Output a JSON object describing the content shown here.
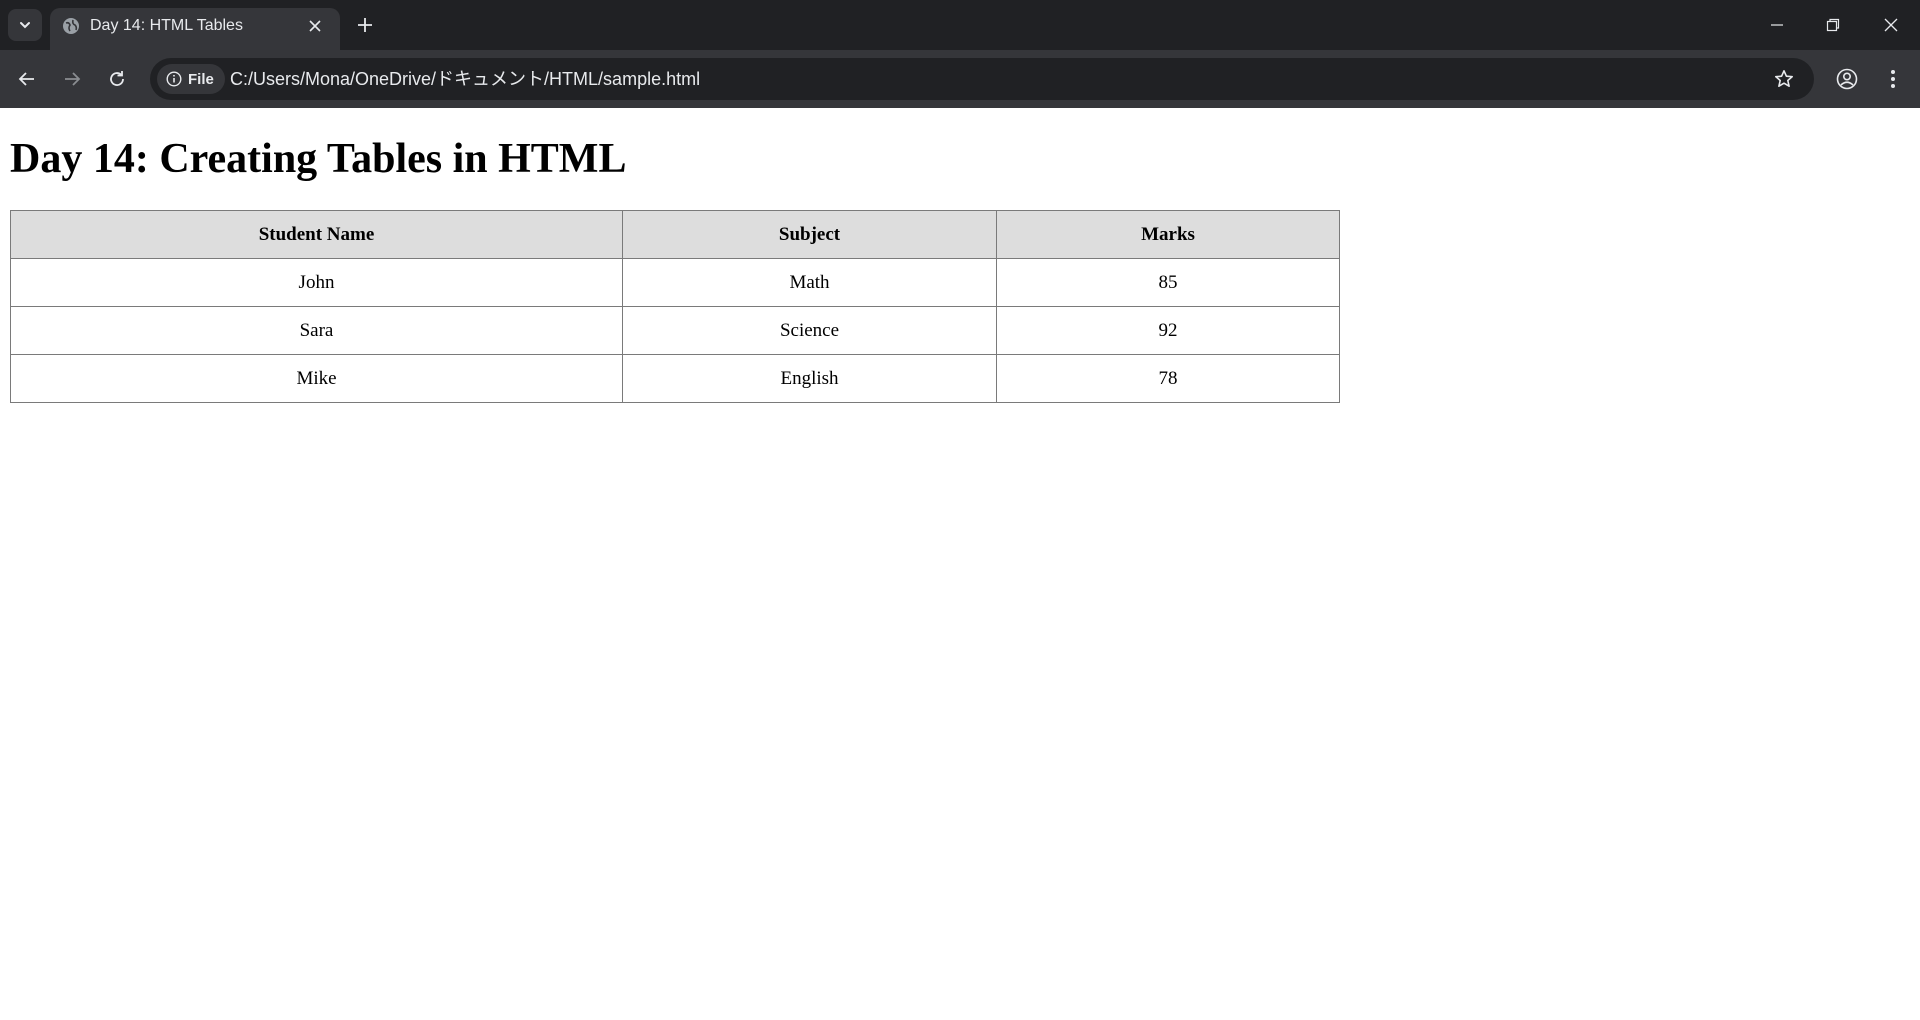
{
  "browser": {
    "tab": {
      "title": "Day 14: HTML Tables"
    },
    "omnibox": {
      "chip_label": "File",
      "url": "C:/Users/Mona/OneDrive/ドキュメント/HTML/sample.html"
    }
  },
  "page": {
    "heading": "Day 14: Creating Tables in HTML",
    "table": {
      "headers": [
        "Student Name",
        "Subject",
        "Marks"
      ],
      "rows": [
        [
          "John",
          "Math",
          "85"
        ],
        [
          "Sara",
          "Science",
          "92"
        ],
        [
          "Mike",
          "English",
          "78"
        ]
      ]
    }
  },
  "colors": {
    "titlebar": "#202124",
    "toolbar": "#35363a",
    "table_header_bg": "#dddddd",
    "table_border": "#7a7a7a"
  },
  "icons": [
    "tab-search-icon",
    "globe-icon",
    "close-icon",
    "plus-icon",
    "minimize-icon",
    "restore-icon",
    "window-close-icon",
    "back-arrow-icon",
    "forward-arrow-icon",
    "reload-icon",
    "info-icon",
    "star-icon",
    "profile-icon",
    "kebab-menu-icon"
  ]
}
